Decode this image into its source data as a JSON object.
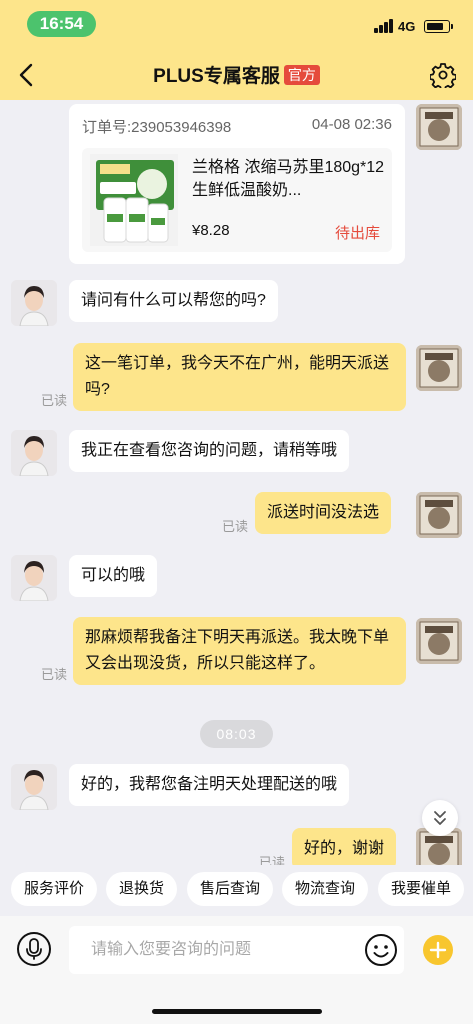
{
  "status_bar": {
    "time": "16:54",
    "network": "4G",
    "battery_level": 0.8
  },
  "nav": {
    "title": "PLUS专属客服",
    "badge": "官方",
    "back_icon": "back-arrow-icon",
    "settings_icon": "gear-icon"
  },
  "order_card": {
    "order_no": "订单号:239053946398",
    "date": "04-08 02:36",
    "product_name": "兰格格 浓缩马苏里180g*12 生鲜低温酸奶...",
    "price": "¥8.28",
    "status": "待出库"
  },
  "messages": [
    {
      "side": "left",
      "text": "请问有什么可以帮您的吗?"
    },
    {
      "side": "right",
      "text": "这一笔订单，我今天不在广州，能明天派送吗?",
      "read": "已读"
    },
    {
      "side": "left",
      "text": "我正在查看您咨询的问题，请稍等哦"
    },
    {
      "side": "right",
      "text": "派送时间没法选",
      "read": "已读"
    },
    {
      "side": "left",
      "text": "可以的哦"
    },
    {
      "side": "right",
      "text": "那麻烦帮我备注下明天再派送。我太晚下单又会出现没货，所以只能这样了。",
      "read": "已读"
    },
    {
      "side": "left",
      "text": "好的，我帮您备注明天处理配送的哦"
    },
    {
      "side": "right",
      "text": "好的，谢谢",
      "read": "已读"
    }
  ],
  "time_divider": "08:03",
  "quick_replies": [
    "服务评价",
    "退换货",
    "售后查询",
    "物流查询",
    "我要催单"
  ],
  "input": {
    "placeholder": "请输入您要咨询的问题"
  },
  "colors": {
    "accent_yellow": "#fde58b",
    "badge_red": "#e54b3c",
    "status_red": "#e54b3c",
    "plus_yellow": "#f8c62e",
    "time_green": "#4cc36d"
  }
}
